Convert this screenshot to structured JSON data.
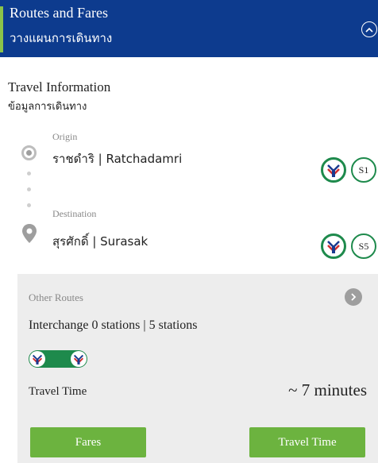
{
  "header": {
    "title": "Routes and Fares",
    "subtitle": "วางแผนการเดินทาง",
    "collapse_icon": "chevron-up-icon"
  },
  "travel_info": {
    "title": "Travel Information",
    "subtitle": "ข้อมูลการเดินทาง"
  },
  "origin": {
    "label": "Origin",
    "name": "ราชดำริ | Ratchadamri",
    "line_icon": "bts-logo-icon",
    "code": "S1"
  },
  "destination": {
    "label": "Destination",
    "name": "สุรศักดิ์ | Surasak",
    "line_icon": "bts-logo-icon",
    "code": "S5"
  },
  "other_routes": {
    "label": "Other Routes",
    "arrow_icon": "arrow-right-icon",
    "interchange": "Interchange 0 stations | 5 stations",
    "travel_time_label": "Travel Time",
    "travel_time_value": "~ 7 minutes"
  },
  "buttons": {
    "fares": "Fares",
    "travel_time": "Travel Time"
  },
  "colors": {
    "header_bg": "#0d3b8e",
    "header_accent": "#8bc34a",
    "line_green": "#1e8a4c",
    "button_green": "#6cb33f",
    "panel_bg": "#ededed"
  }
}
